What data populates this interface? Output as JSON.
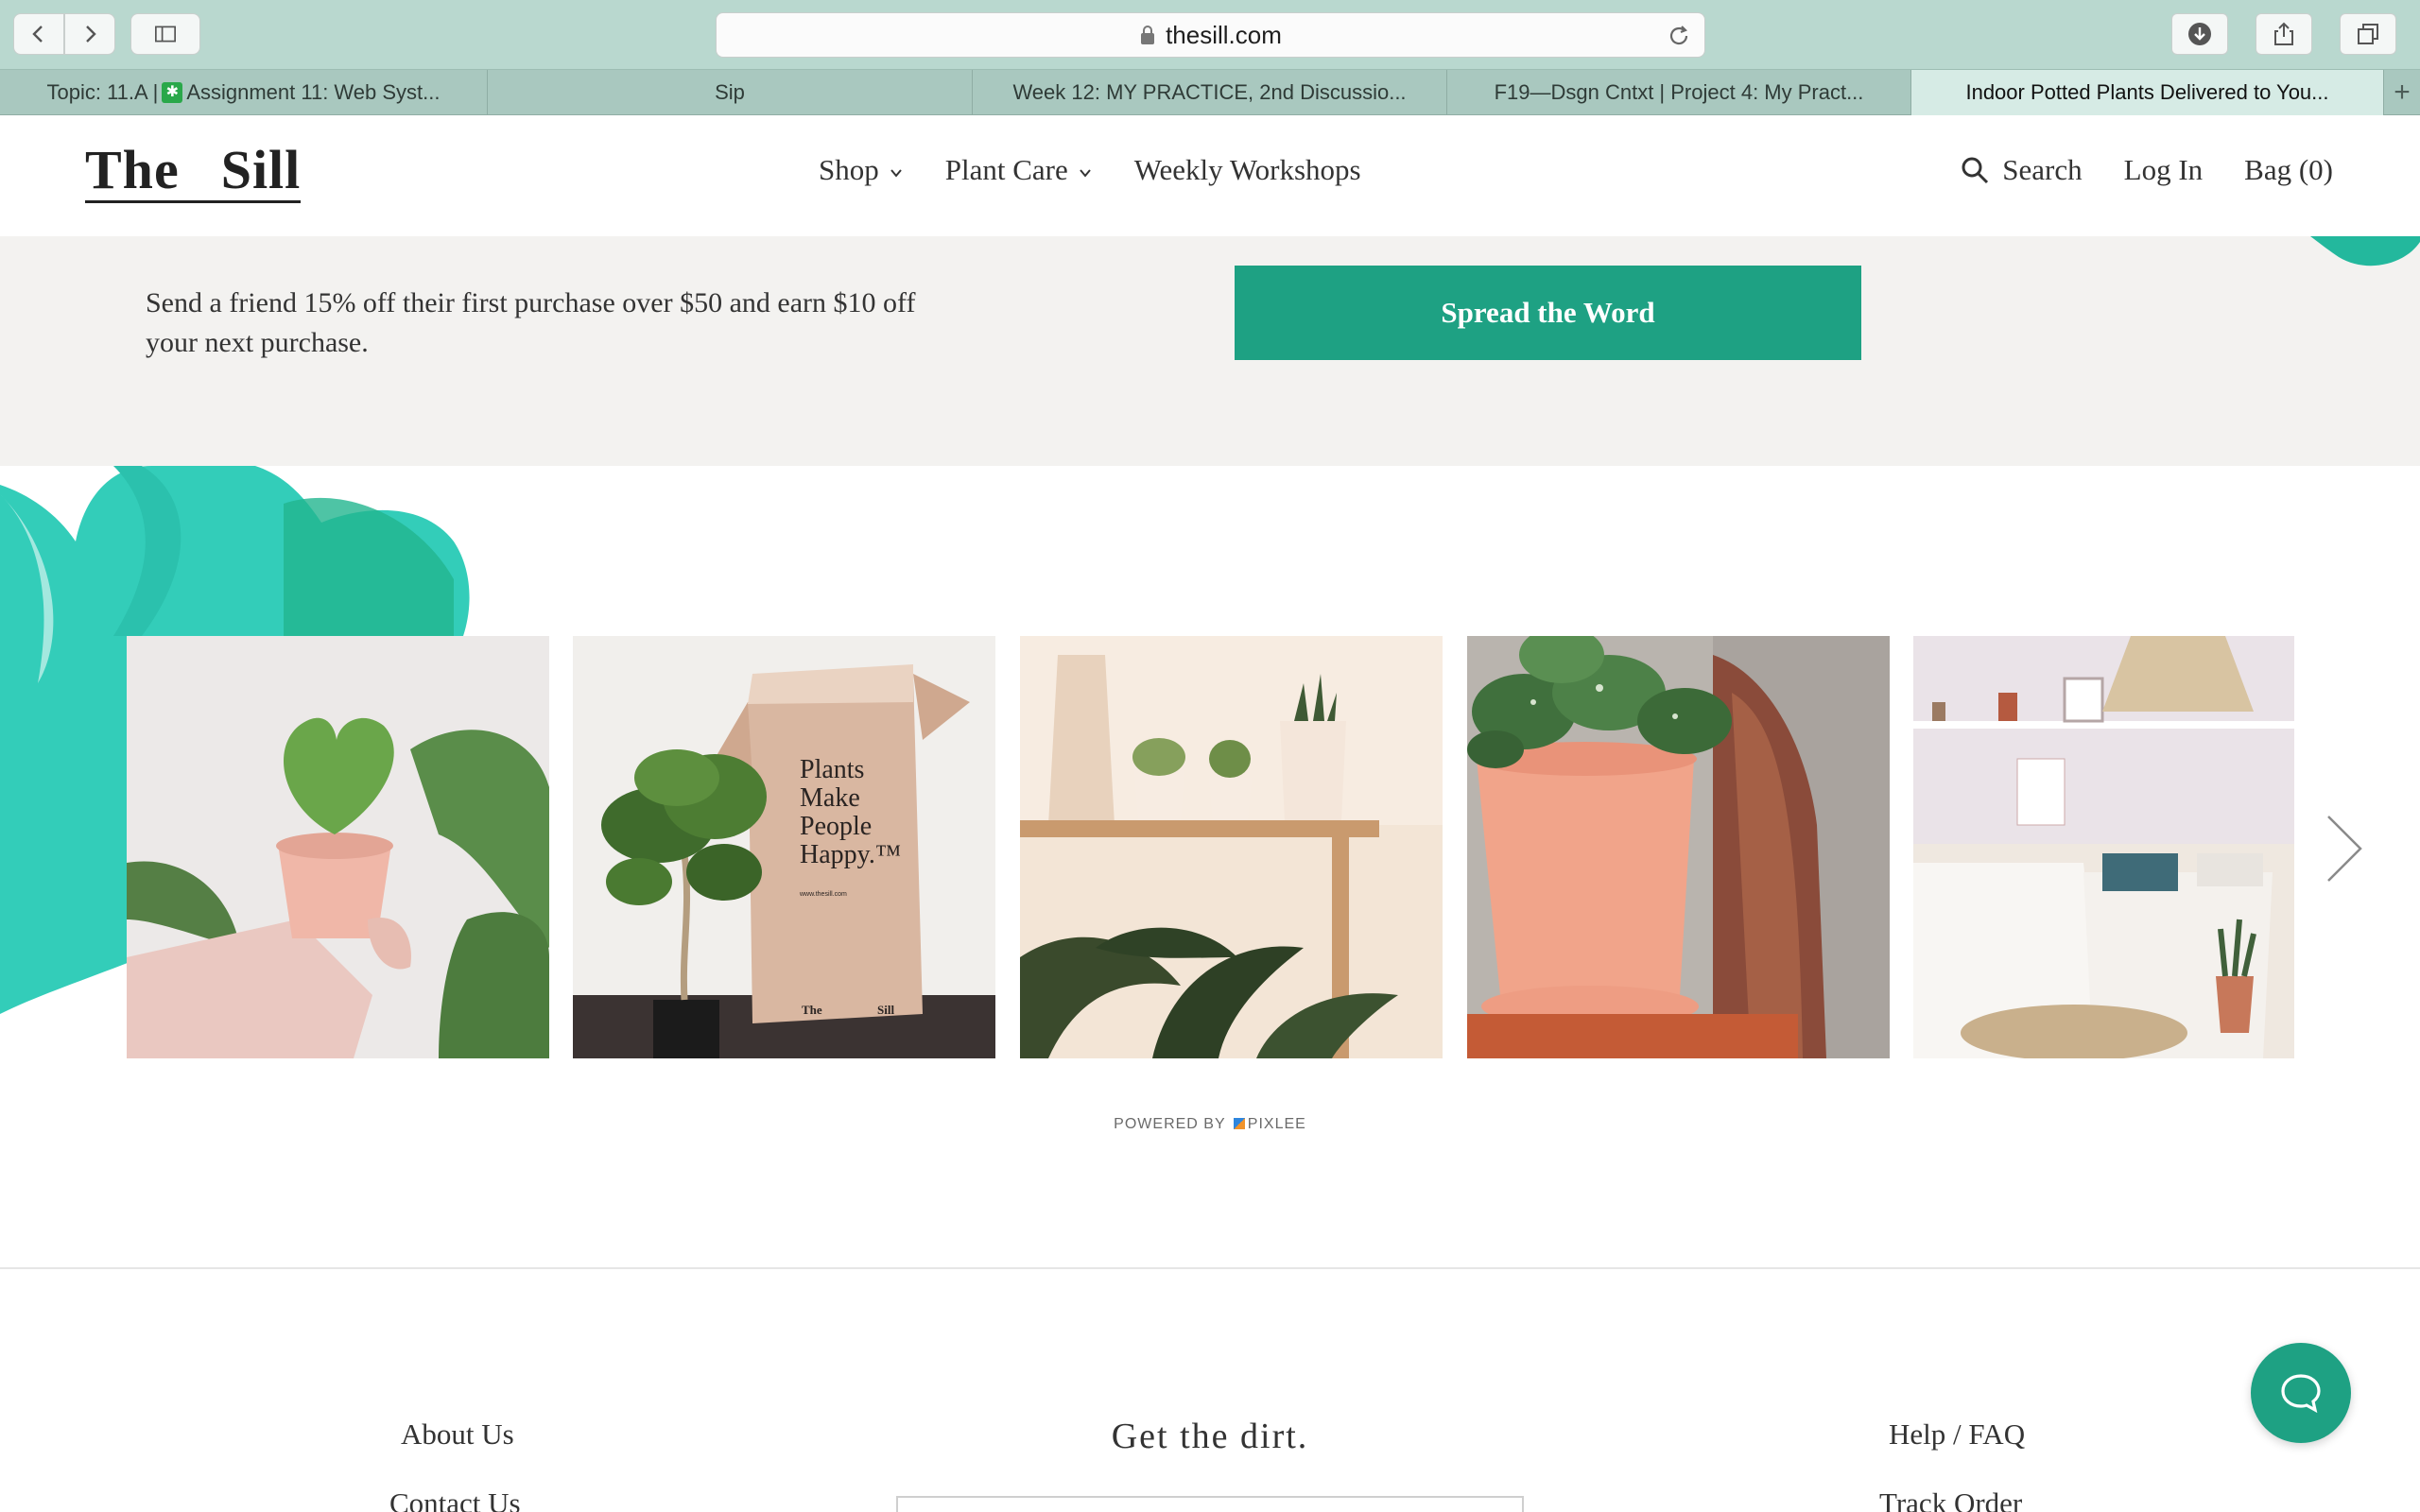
{
  "browser": {
    "url": "thesill.com",
    "tabs": [
      {
        "label": "Topic: 11.A | ",
        "label2": "Assignment 11: Web Syst...",
        "icon": "asterisk-favicon"
      },
      {
        "label": "Sip"
      },
      {
        "label": "Week 12: MY PRACTICE, 2nd Discussio..."
      },
      {
        "label": "F19—Dsgn Cntxt | Project 4: My Pract..."
      },
      {
        "label": "Indoor Potted Plants Delivered to You..."
      }
    ],
    "new_tab_symbol": "+"
  },
  "header": {
    "logo_word1": "The",
    "logo_word2": "Sill",
    "nav": [
      {
        "label": "Shop",
        "has_dropdown": true
      },
      {
        "label": "Plant Care",
        "has_dropdown": true
      },
      {
        "label": "Weekly Workshops",
        "has_dropdown": false
      }
    ],
    "search_label": "Search",
    "login_label": "Log In",
    "bag_label": "Bag (0)"
  },
  "referral": {
    "text": "Send a friend 15% off their first purchase over $50 and earn $10 off your next purchase.",
    "button_label": "Spread the Word"
  },
  "gallery": {
    "photos": [
      {
        "subject": "hand-holding-heart-hoya-pink-pot"
      },
      {
        "subject": "money-tree-beside-plants-make-people-happy-box",
        "box_text_1": "Plants",
        "box_text_2": "Make",
        "box_text_3": "People",
        "box_text_4": "Happy.™",
        "box_small": "www.thesill.com",
        "box_logo_1": "The",
        "box_logo_2": "Sill"
      },
      {
        "subject": "succulents-on-shelf-staghorn-fern"
      },
      {
        "subject": "pothos-in-terracotta-pot"
      },
      {
        "subject": "boho-bedroom-with-snake-plant"
      }
    ],
    "powered_by_prefix": "POWERED BY",
    "powered_by_brand": "PIXLEE"
  },
  "footer": {
    "about": "About Us",
    "contact": "Contact Us",
    "newsletter_title": "Get the dirt.",
    "help": "Help / FAQ",
    "track": "Track Order"
  },
  "colors": {
    "brand_green": "#1ea183",
    "leaf_teal": "#33cdb9",
    "chrome": "#b9d8cf"
  }
}
